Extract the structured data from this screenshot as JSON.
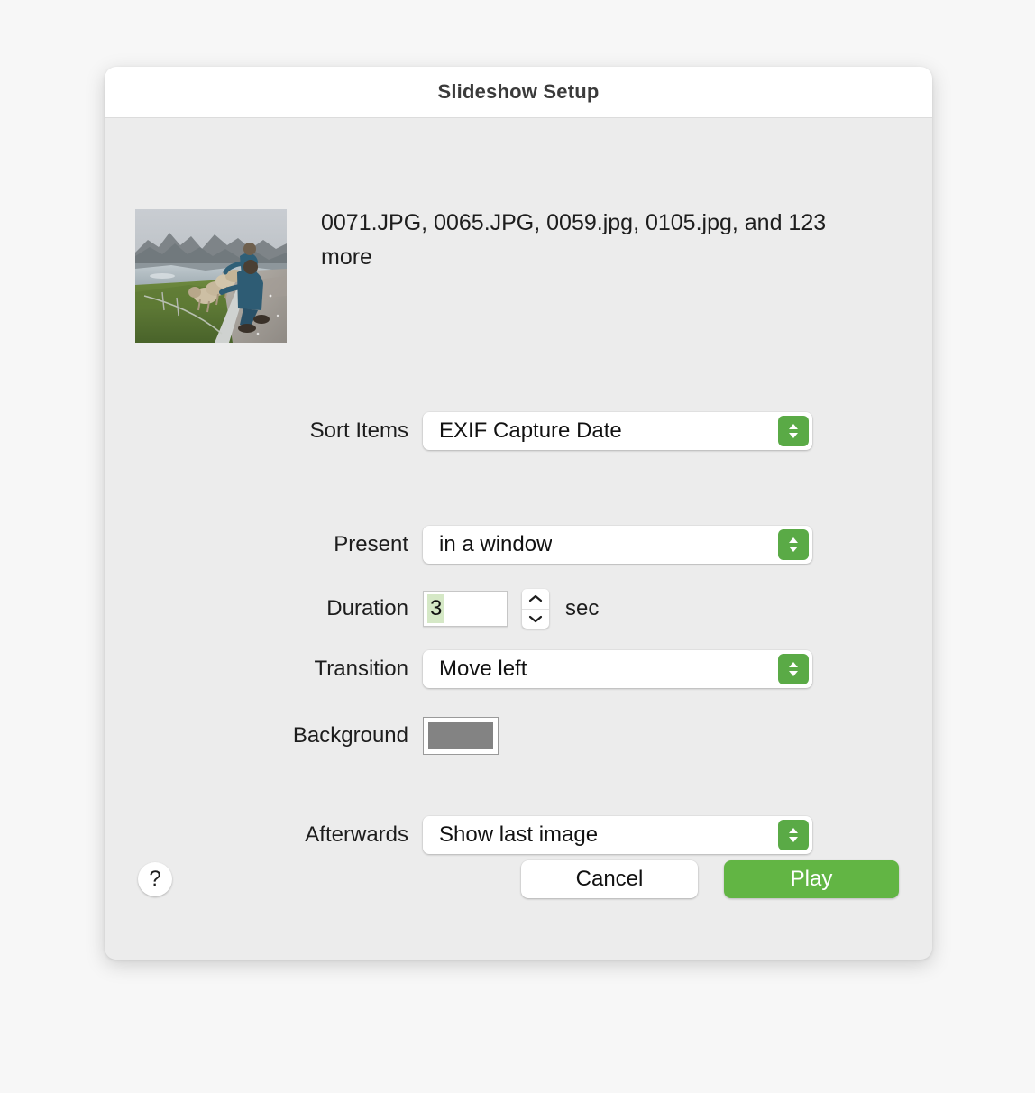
{
  "window": {
    "title": "Slideshow Setup"
  },
  "header": {
    "thumbnail_alt": "photo-thumbnail",
    "file_list": "0071.JPG, 0065.JPG, 0059.jpg, 0105.jpg, and 123 more"
  },
  "form": {
    "sort_items": {
      "label": "Sort Items",
      "value": "EXIF Capture Date"
    },
    "present": {
      "label": "Present",
      "value": "in a window"
    },
    "duration": {
      "label": "Duration",
      "value": "3",
      "unit": "sec",
      "stepper_up_icon": "chevron-up-icon",
      "stepper_down_icon": "chevron-down-icon"
    },
    "transition": {
      "label": "Transition",
      "value": "Move left"
    },
    "background": {
      "label": "Background",
      "color": "#838383"
    },
    "afterwards": {
      "label": "Afterwards",
      "value": "Show last image"
    }
  },
  "footer": {
    "help_label": "?",
    "cancel_label": "Cancel",
    "play_label": "Play"
  },
  "colors": {
    "accent_green": "#5aaa46",
    "play_green": "#62b544",
    "dialog_background": "#ececec",
    "titlebar_background": "#ffffff",
    "selection_green": "#d5e8c6"
  },
  "icons": {
    "popup_arrows": "up-down-chevron-icon",
    "help": "question-mark-icon"
  }
}
